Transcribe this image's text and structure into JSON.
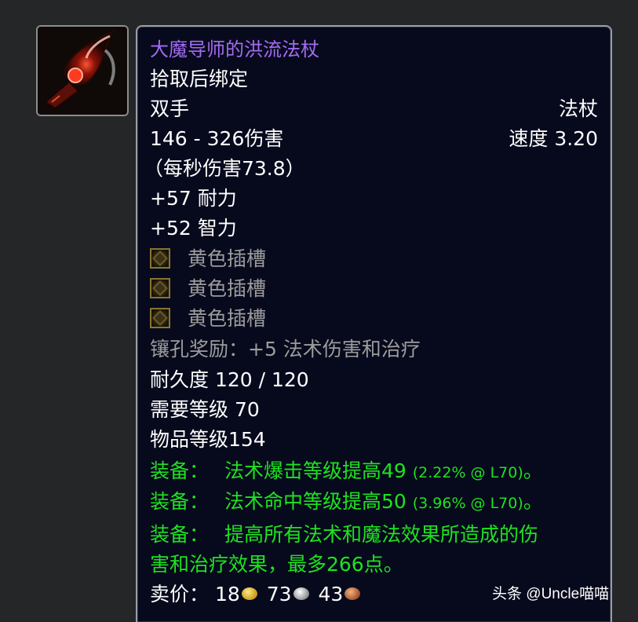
{
  "item": {
    "icon": "staff-icon",
    "name": "大魔导师的洪流法杖",
    "bind": "拾取后绑定",
    "slot": "双手",
    "type": "法杖",
    "damage": "146 - 326伤害",
    "speed": "速度 3.20",
    "dps": "（每秒伤害73.8）",
    "stats": [
      "+57 耐力",
      "+52 智力"
    ],
    "sockets": [
      "黄色插槽",
      "黄色插槽",
      "黄色插槽"
    ],
    "socket_icon": "yellow-socket-icon",
    "socket_bonus": "镶孔奖励：+5 法术伤害和治疗",
    "durability": "耐久度 120 / 120",
    "required_level": "需要等级 70",
    "item_level": "物品等级154",
    "equips": [
      {
        "label": "装备：",
        "text": "法术爆击等级提高49 ",
        "note": "(2.22% @ L70)",
        "end": "。"
      },
      {
        "label": "装备：",
        "text": "法术命中等级提高50 ",
        "note": "(3.96% @ L70)",
        "end": "。"
      },
      {
        "label": "装备：",
        "text": "提高所有法术和魔法效果所造成的伤",
        "line2": "害和治疗效果，最多266点。"
      }
    ],
    "sell_label": "卖价：",
    "sell_gold": "18",
    "sell_silver": "73",
    "sell_copper": "43"
  },
  "watermark": "头条 @Uncle喵喵",
  "colors": {
    "background": "#252628",
    "tooltip_bg": "#070a1d",
    "epic_name": "#a36cf2",
    "green_text": "#1fe21f",
    "gray_text": "#9c9c9c"
  }
}
